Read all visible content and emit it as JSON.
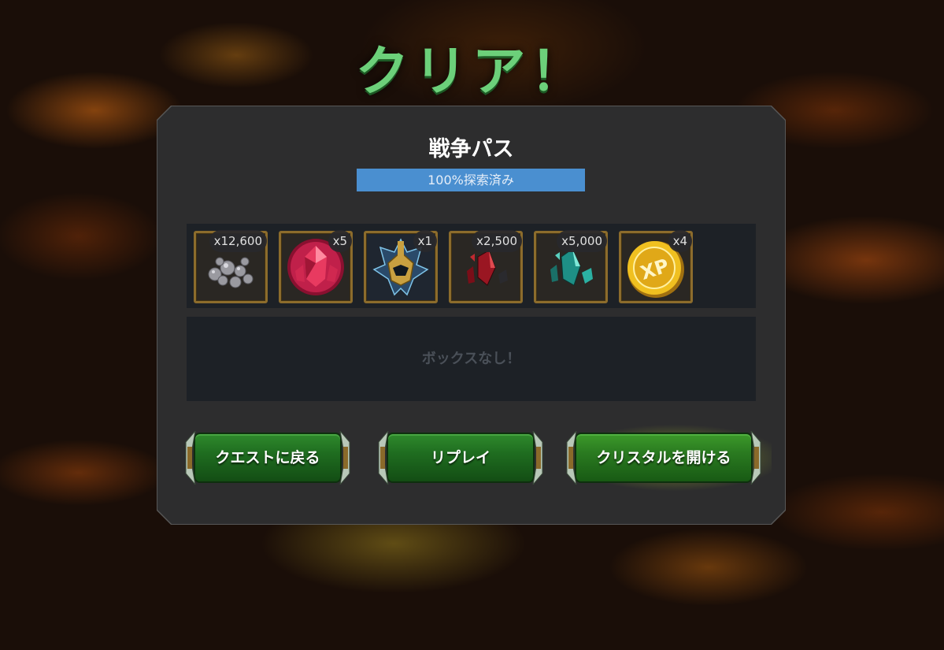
{
  "title": "クリア！",
  "panel": {
    "title": "戦争パス",
    "progress": {
      "label": "100%探索済み",
      "fraction": 1.0
    }
  },
  "rewards": [
    {
      "name": "silver-ore-icon",
      "quantity": "x12,600"
    },
    {
      "name": "red-crystal-icon",
      "quantity": "x5"
    },
    {
      "name": "armored-helmet-icon",
      "quantity": "x1"
    },
    {
      "name": "red-shards-icon",
      "quantity": "x2,500"
    },
    {
      "name": "teal-shards-icon",
      "quantity": "x5,000"
    },
    {
      "name": "xp-coin-icon",
      "quantity": "x4"
    }
  ],
  "boxes": {
    "empty_text": "ボックスなし！"
  },
  "buttons": {
    "back": "クエストに戻る",
    "replay": "リプレイ",
    "open_crystal": "クリスタルを開ける"
  },
  "colors": {
    "title_green": "#6cd07a",
    "progress_blue": "#3c82c4",
    "frame_gold": "#8c6c2c",
    "button_green": "#1f6d20"
  }
}
